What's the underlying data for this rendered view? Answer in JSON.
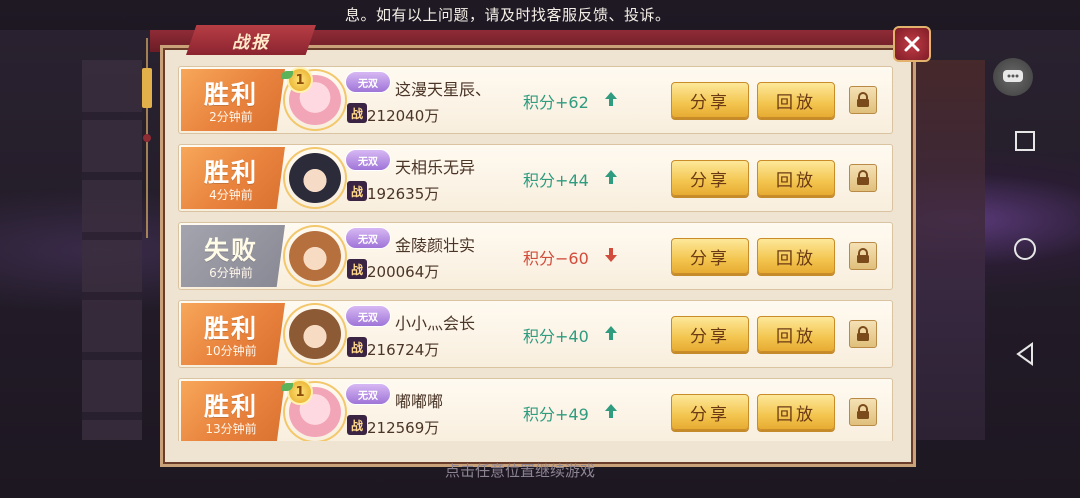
{
  "notice": {
    "text": "息。如有以上问题，请及时找客服反馈、投诉。"
  },
  "dialog": {
    "title": "战报"
  },
  "bottom_hint": "点击任意位置继续游戏",
  "records": [
    {
      "result": "胜利",
      "time": "2分钟前",
      "tier": "无双",
      "name": "这漫天星辰、",
      "power": "212040万",
      "score": "积分+62",
      "trend": "up",
      "medal": "1",
      "outcome": "win",
      "share": "分享",
      "replay": "回放"
    },
    {
      "result": "胜利",
      "time": "4分钟前",
      "tier": "无双",
      "name": "天相乐无异",
      "power": "192635万",
      "score": "积分+44",
      "trend": "up",
      "medal": "",
      "outcome": "win",
      "share": "分享",
      "replay": "回放"
    },
    {
      "result": "失败",
      "time": "6分钟前",
      "tier": "无双",
      "name": "金陵颜壮实",
      "power": "200064万",
      "score": "积分−60",
      "trend": "down",
      "medal": "",
      "outcome": "lose",
      "share": "分享",
      "replay": "回放"
    },
    {
      "result": "胜利",
      "time": "10分钟前",
      "tier": "无双",
      "name": "小小灬会长",
      "power": "216724万",
      "score": "积分+40",
      "trend": "up",
      "medal": "",
      "outcome": "win",
      "share": "分享",
      "replay": "回放"
    },
    {
      "result": "胜利",
      "time": "13分钟前",
      "tier": "无双",
      "name": "嘟嘟嘟",
      "power": "212569万",
      "score": "积分+49",
      "trend": "up",
      "medal": "1",
      "outcome": "win",
      "share": "分享",
      "replay": "回放"
    }
  ],
  "colors": {
    "win": "#e8823d",
    "lose": "#888894",
    "score_up": "#2f9b7f",
    "score_down": "#d24c3b"
  }
}
